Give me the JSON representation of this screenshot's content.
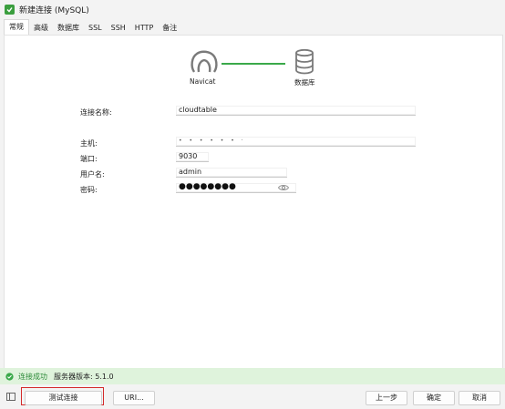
{
  "window": {
    "title": "新建连接 (MySQL)"
  },
  "tabs": [
    {
      "label": "常规",
      "active": true
    },
    {
      "label": "高级",
      "active": false
    },
    {
      "label": "数据库",
      "active": false
    },
    {
      "label": "SSL",
      "active": false
    },
    {
      "label": "SSH",
      "active": false
    },
    {
      "label": "HTTP",
      "active": false
    },
    {
      "label": "备注",
      "active": false
    }
  ],
  "graphic": {
    "left_caption": "Navicat",
    "right_caption": "数据库",
    "accent_color": "#3aa94a"
  },
  "form": {
    "connection_name": {
      "label": "连接名称:",
      "value": "cloudtable"
    },
    "host": {
      "label": "主机:",
      "value": "• • • • • • ·"
    },
    "port": {
      "label": "端口:",
      "value": "9030"
    },
    "username": {
      "label": "用户名:",
      "value": "admin"
    },
    "password": {
      "label": "密码:",
      "value": "●●●●●●●●",
      "icon": "eye-icon"
    }
  },
  "status": {
    "icon": "check-circle-icon",
    "message": "连接成功",
    "server_version": "服务器版本: 5.1.0",
    "color": "#2e8b3a"
  },
  "footer": {
    "test_label": "测试连接",
    "uri_label": "URI...",
    "prev_label": "上一步",
    "ok_label": "确定",
    "cancel_label": "取消"
  }
}
